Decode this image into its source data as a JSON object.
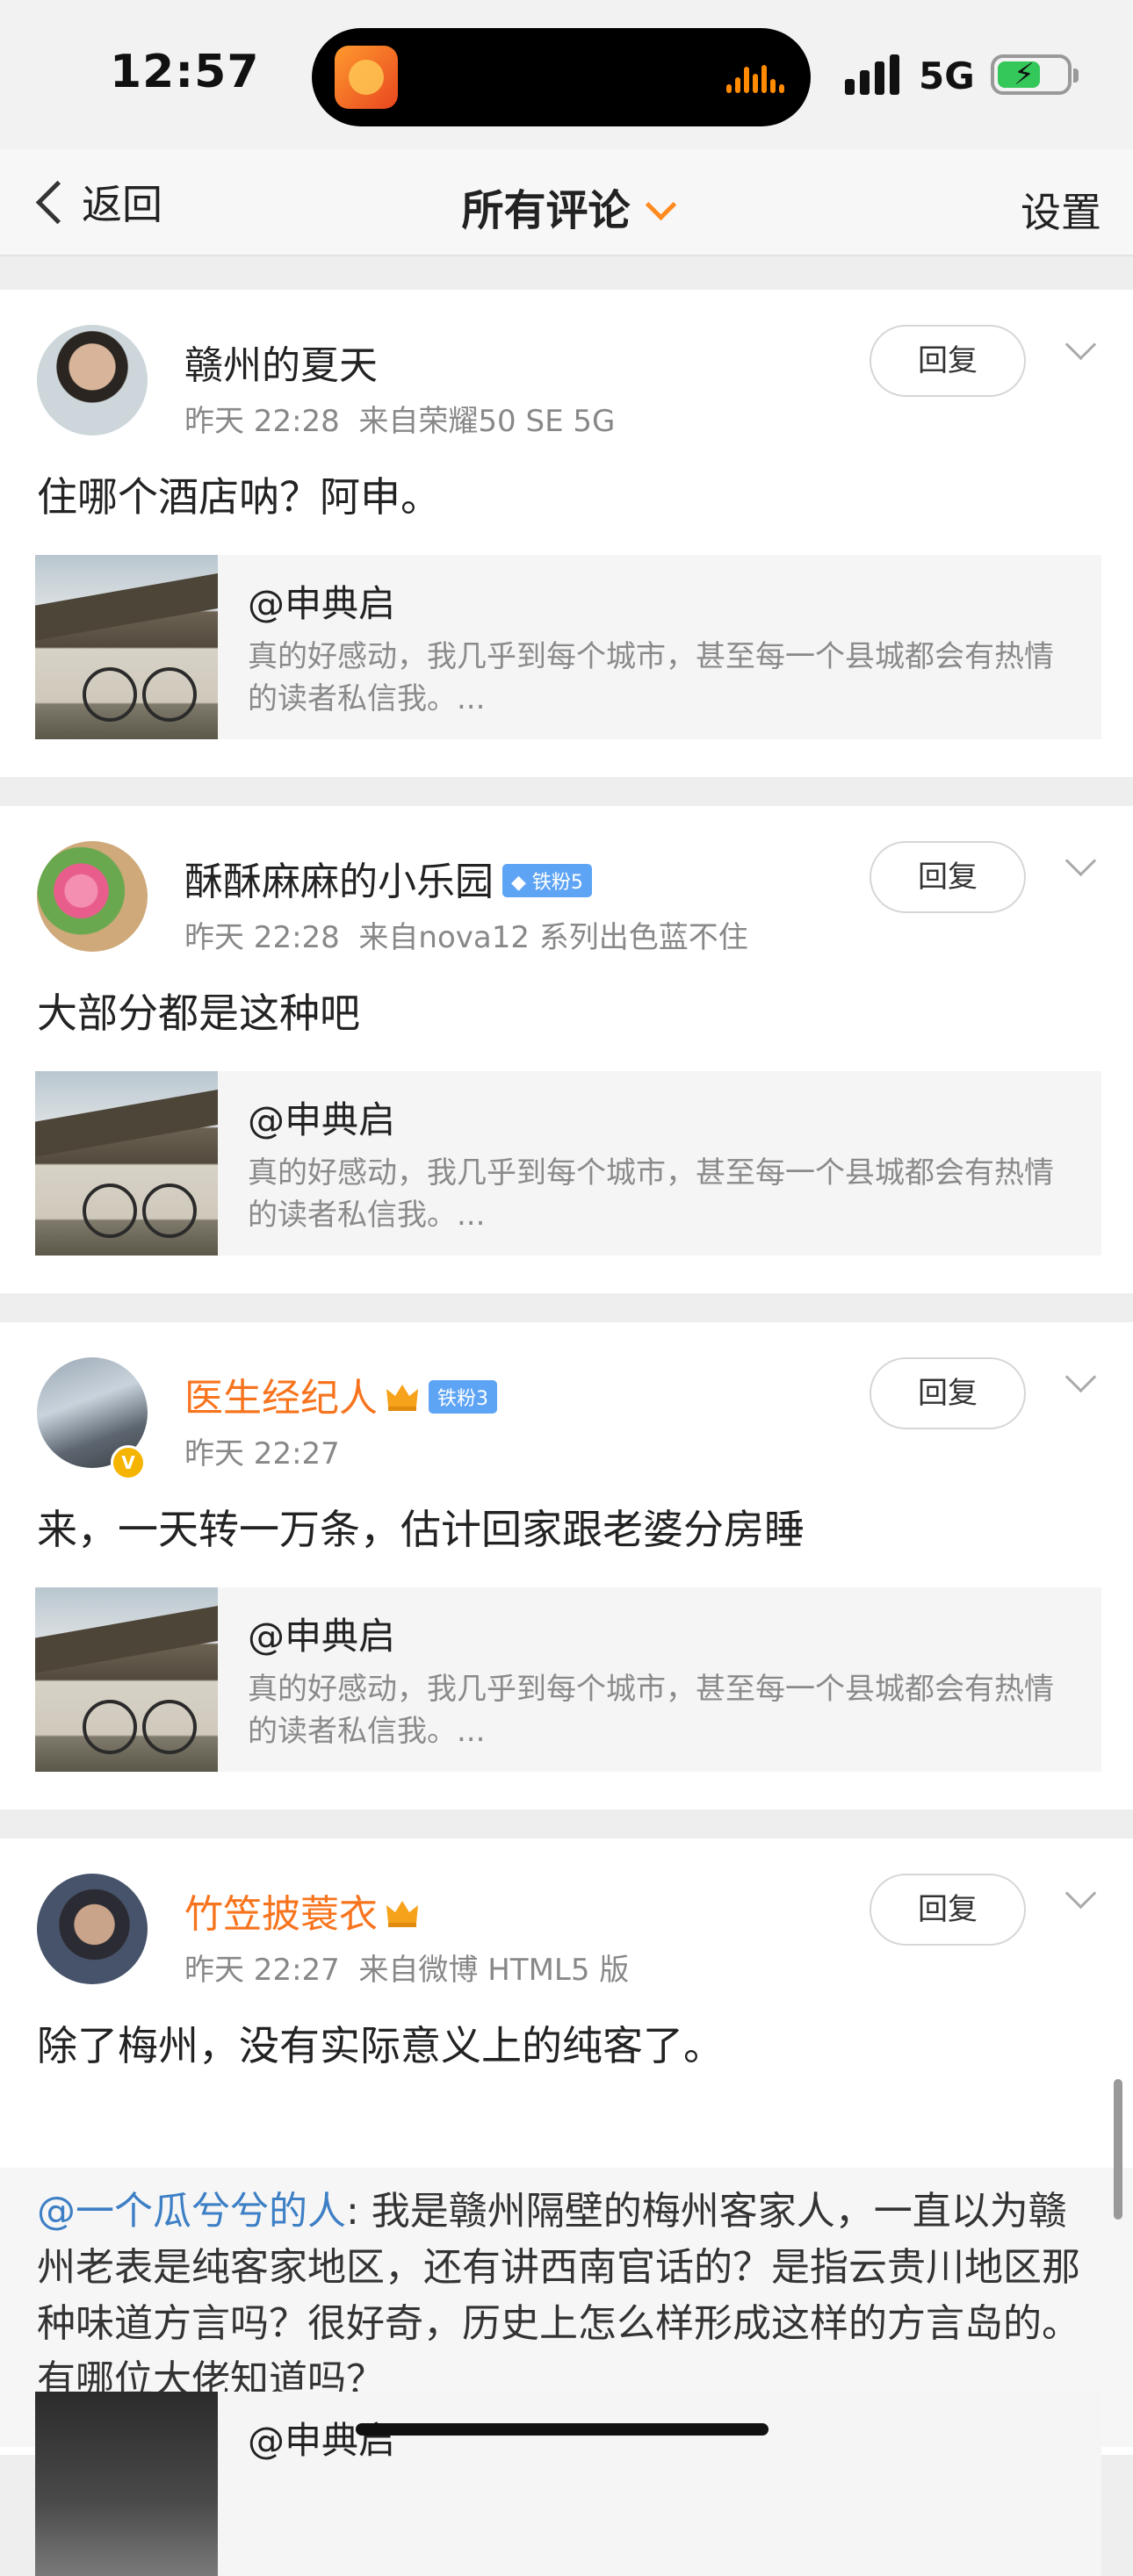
{
  "status_bar": {
    "time": "12:57",
    "network": "5G",
    "battery_charging": true
  },
  "nav": {
    "back_label": "返回",
    "title": "所有评论",
    "settings_label": "设置"
  },
  "comments": [
    {
      "username": "赣州的夏天",
      "time": "昨天 22:28",
      "source": "来自荣耀50 SE 5G",
      "text": "住哪个酒店呐？阿申。",
      "reply_label": "回复",
      "quote": {
        "title": "@申典启",
        "body": "真的好感动，我几乎到每个城市，甚至每一个县城都会有热情的读者私信我。..."
      }
    },
    {
      "username": "酥酥麻麻的小乐园",
      "badge": "铁粉5",
      "time": "昨天 22:28",
      "source": "来自nova12 系列出色蓝不住",
      "text": "大部分都是这种吧",
      "reply_label": "回复",
      "quote": {
        "title": "@申典启",
        "body": "真的好感动，我几乎到每个城市，甚至每一个县城都会有热情的读者私信我。..."
      }
    },
    {
      "username": "医生经纪人",
      "badge": "铁粉3",
      "verified_badge": "V",
      "time": "昨天 22:27",
      "text": "来，一天转一万条，估计回家跟老婆分房睡",
      "reply_label": "回复",
      "quote": {
        "title": "@申典启",
        "body": "真的好感动，我几乎到每个城市，甚至每一个县城都会有热情的读者私信我。..."
      }
    },
    {
      "username": "竹笠披蓑衣",
      "time": "昨天 22:27",
      "source": "来自微博 HTML5 版",
      "text": "除了梅州，没有实际意义上的纯客了。",
      "reply_label": "回复",
      "forward_mention": "@一个瓜兮兮的人",
      "forward_text": ": 我是赣州隔壁的梅州客家人，一直以为赣州老表是纯客家地区，还有讲西南官话的？是指云贵川地区那种味道方言吗？很好奇，历史上怎么样形成这样的方言岛的。有哪位大佬知道吗？",
      "quote": {
        "title": "@申典启"
      }
    }
  ],
  "colors": {
    "vip_name": "#f7741e",
    "fan_badge": "#5ea4f5",
    "mention": "#3d7fc5",
    "accent": "#ff8a1f"
  }
}
